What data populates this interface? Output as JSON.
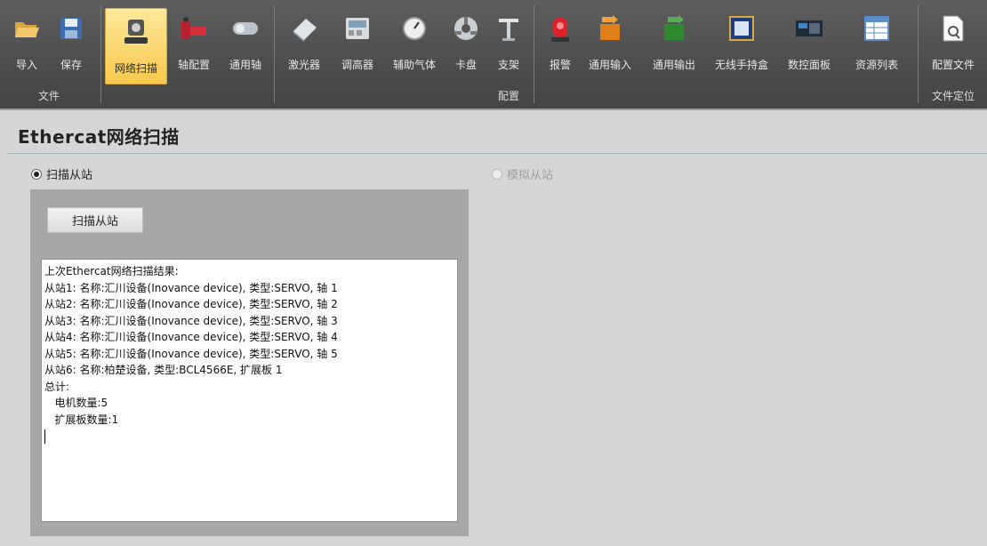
{
  "ribbon": {
    "groups": {
      "file": "文件",
      "config": "配置",
      "file_locate": "文件定位"
    },
    "buttons": {
      "import": "导入",
      "save": "保存",
      "net_scan": "网络扫描",
      "axis_config": "轴配置",
      "general_axis": "通用轴",
      "laser": "激光器",
      "height_adjuster": "调高器",
      "aux_gas": "辅助气体",
      "chuck": "卡盘",
      "bracket": "支架",
      "alarm": "报警",
      "general_input": "通用输入",
      "general_output": "通用输出",
      "wireless_handbox": "无线手持盒",
      "cnc_panel": "数控面板",
      "resource_list": "资源列表",
      "config_file": "配置文件"
    },
    "active": "net_scan"
  },
  "page": {
    "title": "Ethercat网络扫描",
    "radio_scan": "扫描从站",
    "radio_simulate": "模拟从站",
    "scan_button": "扫描从站"
  },
  "result": {
    "lines": [
      "上次Ethercat网络扫描结果:",
      "从站1: 名称:汇川设备(Inovance device), 类型:SERVO, 轴 1",
      "从站2: 名称:汇川设备(Inovance device), 类型:SERVO, 轴 2",
      "从站3: 名称:汇川设备(Inovance device), 类型:SERVO, 轴 3",
      "从站4: 名称:汇川设备(Inovance device), 类型:SERVO, 轴 4",
      "从站5: 名称:汇川设备(Inovance device), 类型:SERVO, 轴 5",
      "从站6: 名称:柏楚设备, 类型:BCL4566E, 扩展板 1",
      "总计:",
      "   电机数量:5",
      "   扩展板数量:1"
    ]
  },
  "colors": {
    "ribbon_bg": "#4a4a4a",
    "active_button": "#f7c94c",
    "panel_bg": "#a7a7a9"
  }
}
